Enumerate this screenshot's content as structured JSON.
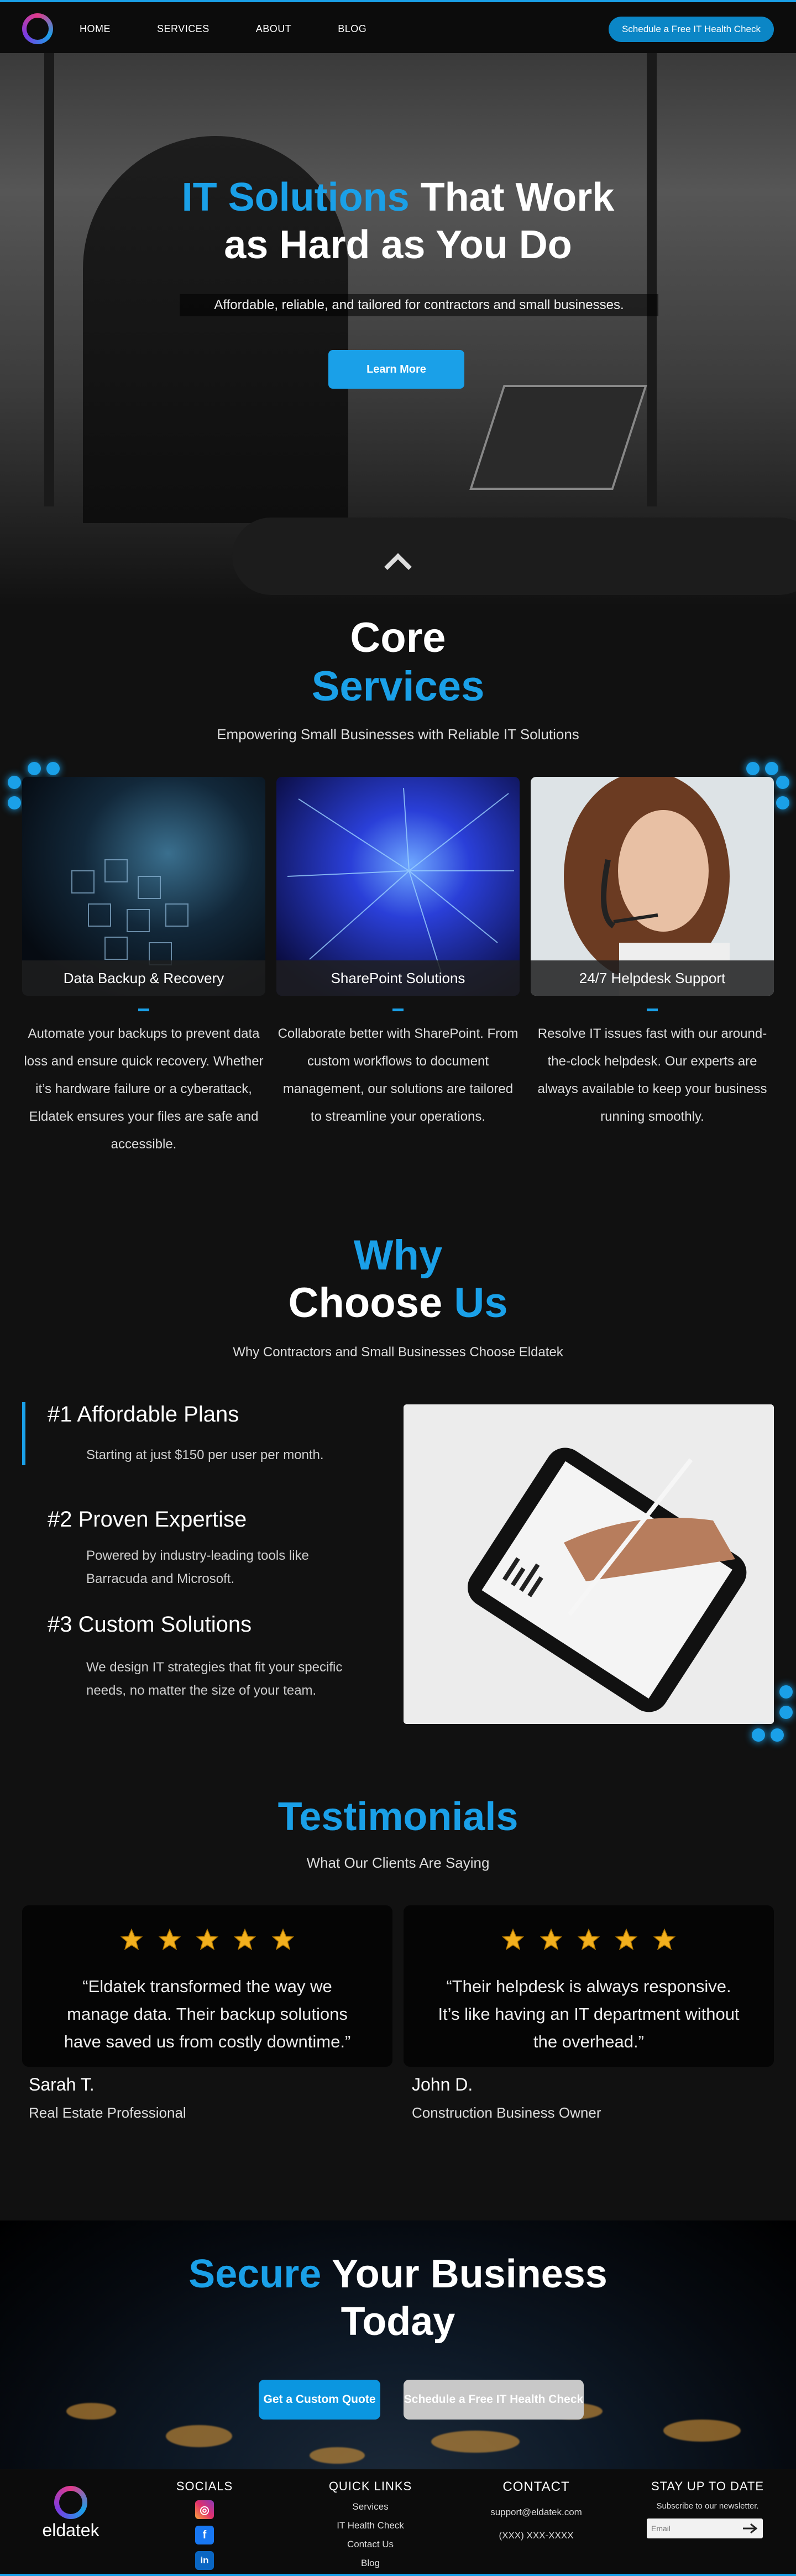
{
  "nav": {
    "links": [
      "HOME",
      "SERVICES",
      "ABOUT",
      "BLOG"
    ],
    "cta": "Schedule a Free IT Health Check"
  },
  "hero": {
    "title_accent": "IT Solutions",
    "title_rest_1": " That Work",
    "title_line2": "as Hard as You Do",
    "subtitle": "Affordable, reliable, and tailored for contractors and small businesses.",
    "button": "Learn More"
  },
  "core": {
    "title_line1": "Core",
    "title_line2": "Services",
    "subtitle": "Empowering Small Businesses with Reliable IT Solutions",
    "services": [
      {
        "title": "Data Backup & Recovery",
        "text": "Automate your backups to prevent data loss and ensure quick recovery. Whether it’s hardware failure or a cyberattack, Eldatek ensures your files are safe and accessible."
      },
      {
        "title": "SharePoint Solutions",
        "text": "Collaborate better with SharePoint. From custom workflows to document management, our solutions are tailored to streamline your operations."
      },
      {
        "title": "24/7 Helpdesk Support",
        "text": "Resolve IT issues fast with our around-the-clock helpdesk. Our experts are always available to keep your business running smoothly."
      }
    ]
  },
  "why": {
    "title_line1": "Why",
    "title_line2a": "Choose ",
    "title_line2b": "Us",
    "subtitle": "Why Contractors and Small Businesses Choose Eldatek",
    "items": [
      {
        "title": "#1 Affordable Plans",
        "text": "Starting at just $150 per user per month."
      },
      {
        "title": "#2 Proven Expertise",
        "text": "Powered by industry-leading tools like Barracuda and Microsoft."
      },
      {
        "title": "#3 Custom Solutions",
        "text": "We design IT strategies that fit your specific needs, no matter the size of your team."
      }
    ]
  },
  "testimonials": {
    "title": "Testimonials",
    "subtitle": "What Our Clients Are Saying",
    "items": [
      {
        "quote": "“Eldatek transformed the way we manage data. Their backup solutions have saved us from costly downtime.”",
        "name": "Sarah T.",
        "role": "Real Estate Professional",
        "rating": 5
      },
      {
        "quote": "“Their helpdesk is always responsive. It’s like having an IT department without the overhead.”",
        "name": "John D.",
        "role": "Construction Business Owner",
        "rating": 5
      }
    ]
  },
  "secure": {
    "title_accent": "Secure",
    "title_rest": " Your Business",
    "title_line2": "Today",
    "btn_quote": "Get a Custom Quote",
    "btn_check": "Schedule a Free IT Health Check"
  },
  "footer": {
    "logo_text": "eldatek",
    "socials_head": "SOCIALS",
    "quick_head": "QUICK LINKS",
    "quick_links": [
      "Services",
      "IT Health Check",
      "Contact Us",
      "Blog"
    ],
    "contact_head": "CONTACT",
    "email": "support@eldatek.com",
    "phone": "(XXX) XXX-XXXX",
    "stay_head": "STAY UP TO DATE",
    "stay_sub": "Subscribe to our newsletter.",
    "email_placeholder": "Email"
  },
  "colors": {
    "accent": "#1aa0e8",
    "background": "#111111",
    "star": "#f2b01e"
  }
}
